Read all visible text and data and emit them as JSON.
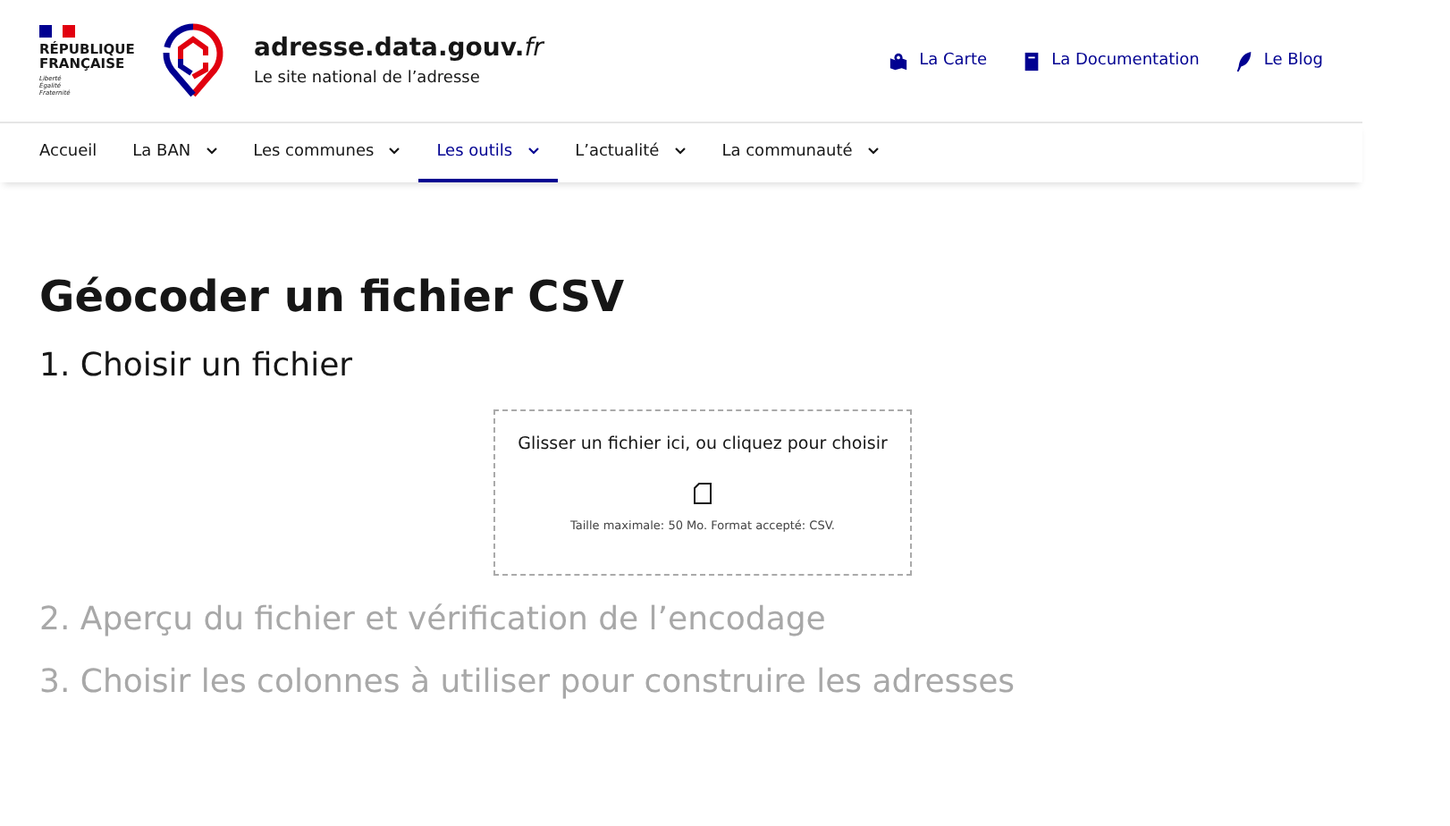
{
  "header": {
    "marianne_lines": [
      "RÉPUBLIQUE",
      "FRANÇAISE"
    ],
    "motto": [
      "Liberté",
      "Égalité",
      "Fraternité"
    ],
    "site_title": "adresse.data.gouv.",
    "site_title_suffix": "fr",
    "tagline": "Le site national de l’adresse",
    "links": [
      {
        "label": "La Carte",
        "kind": "map"
      },
      {
        "label": "La Documentation",
        "kind": "book"
      },
      {
        "label": "Le Blog",
        "kind": "feather"
      }
    ]
  },
  "nav": [
    {
      "label": "Accueil",
      "dropdown": false,
      "selected": false
    },
    {
      "label": "La BAN",
      "dropdown": true,
      "selected": false
    },
    {
      "label": "Les communes",
      "dropdown": true,
      "selected": false
    },
    {
      "label": "Les outils",
      "dropdown": true,
      "selected": true
    },
    {
      "label": "L’actualité",
      "dropdown": true,
      "selected": false
    },
    {
      "label": "La communauté",
      "dropdown": true,
      "selected": false
    }
  ],
  "page_title": "Géocoder un fichier CSV",
  "steps": [
    {
      "title": "1. Choisir un fichier",
      "disabled": false
    },
    {
      "title": "2. Aperçu du fichier et vérification de l’encodage",
      "disabled": true
    },
    {
      "title": "3. Choisir les colonnes à utiliser pour construire les adresses",
      "disabled": true
    }
  ],
  "dropzone": {
    "prompt": "Glisser un fichier ici, ou cliquez pour choisir",
    "hint": "Taille maximale: 50 Mo. Format accepté: CSV."
  }
}
